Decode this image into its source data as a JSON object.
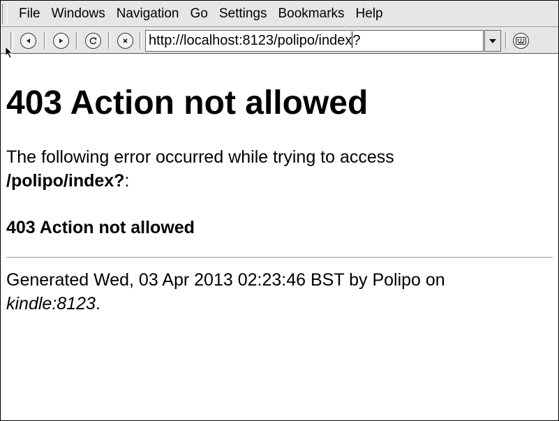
{
  "menubar": {
    "items": [
      "File",
      "Windows",
      "Navigation",
      "Go",
      "Settings",
      "Bookmarks",
      "Help"
    ]
  },
  "toolbar": {
    "buttons": [
      "back-icon",
      "forward-icon",
      "reload-icon",
      "stop-icon",
      "keyboard-icon"
    ],
    "url_before_caret": "http://localhost:8123/polipo/index",
    "url_after_caret": "?"
  },
  "page": {
    "heading": "403 Action not allowed",
    "error_intro": "The following error occurred while trying to access",
    "error_path": "/polipo/index?",
    "error_path_suffix": ":",
    "error_message": "403 Action not allowed",
    "footer_prefix": "Generated Wed, 03 Apr 2013 02:23:46 BST by Polipo on",
    "footer_host": "kindle:8123",
    "footer_suffix": "."
  }
}
